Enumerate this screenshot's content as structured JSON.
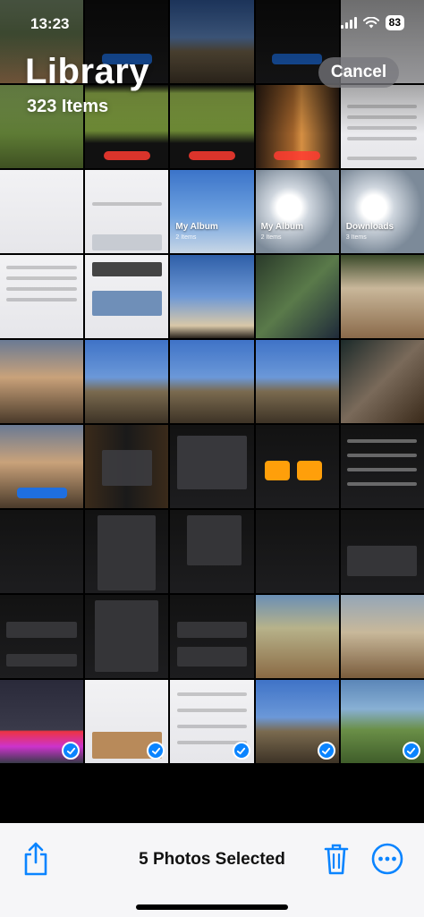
{
  "status_bar": {
    "time": "13:23",
    "battery": "83"
  },
  "header": {
    "title": "Library",
    "subtitle": "323 Items",
    "cancel_label": "Cancel"
  },
  "albums": [
    {
      "name": "My Album",
      "count": "2 Items"
    },
    {
      "name": "My Album",
      "count": "2 Items"
    },
    {
      "name": "Downloads",
      "count": "3 Items"
    }
  ],
  "toolbar": {
    "selection_label": "5 Photos Selected"
  },
  "colors": {
    "accent": "#0a84ff",
    "toolbar_bg": "#f6f6f8"
  }
}
